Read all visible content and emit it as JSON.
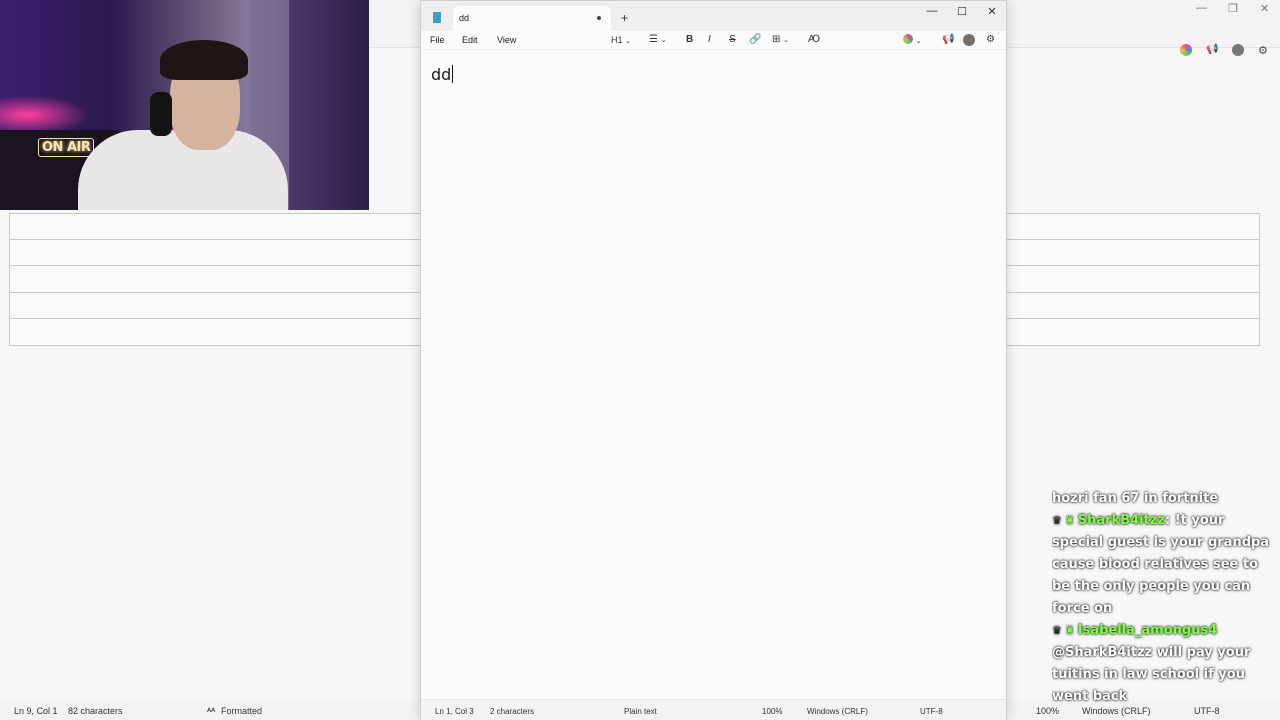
{
  "background_app": {
    "statusbar": {
      "position": "Ln 9, Col 1",
      "chars": "82 characters",
      "mode": "Formatted",
      "zoom": "100%",
      "line_ending": "Windows (CRLF)",
      "encoding": "UTF-8"
    },
    "table_rows": 5
  },
  "webcam": {
    "sign_text": "ON AIR"
  },
  "notepad": {
    "tab_title": "dd",
    "menu": {
      "file": "File",
      "edit": "Edit",
      "view": "View"
    },
    "toolbar": {
      "heading": "H1",
      "list_icon": "list-icon",
      "bold": "B",
      "italic": "I",
      "strikethrough": "S",
      "link_icon": "link-icon",
      "table_icon": "table-icon",
      "clear_format_icon": "clear-format-icon"
    },
    "content": "dd",
    "statusbar": {
      "position": "Ln 1, Col 3",
      "chars": "2 characters",
      "mode": "Plain text",
      "zoom": "100%",
      "line_ending": "Windows (CRLF)",
      "encoding": "UTF-8"
    }
  },
  "chat": {
    "messages": [
      {
        "user": "",
        "text": "hozri fan 67 in fortnite"
      },
      {
        "user": "SharkB4itzz",
        "text": ": !t your special guest is your grandpa cause blood relatives see to be the only people you can force on"
      },
      {
        "user": "Isabella_amongus4",
        "text": ""
      },
      {
        "user": "",
        "text": "@SharkB4itzz will pay your tuitins in law school if you went back"
      }
    ],
    "colors": {
      "username": "#7cff3c",
      "text": "#ffffff"
    }
  }
}
